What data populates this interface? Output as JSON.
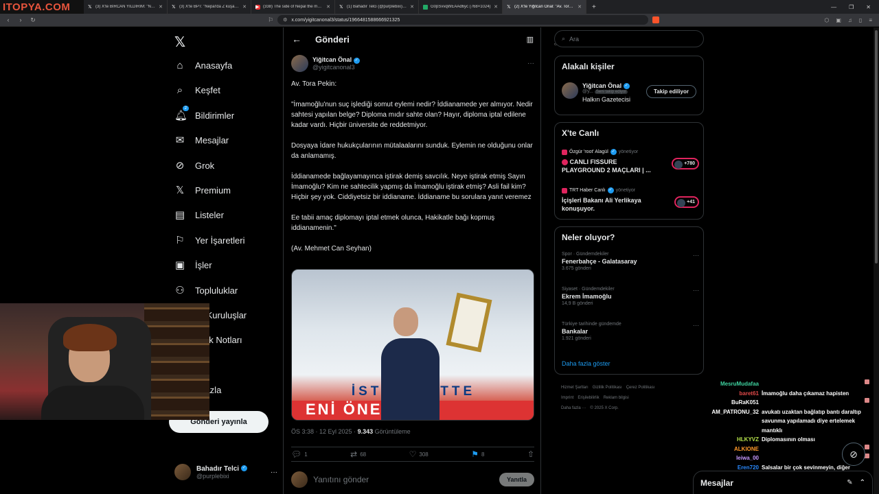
{
  "browser": {
    "watermark": "ITOPYA.COM",
    "tabs": [
      {
        "title": "(3) X'te BİRCAN YILDIRIM: \"Nepal'de",
        "fav": "𝕏",
        "kind": "x"
      },
      {
        "title": "(3) X'te BPT: \"Nepal'da Z kuşağının h",
        "fav": "𝕏",
        "kind": "x"
      },
      {
        "title": "(338) The side of Nepal the media w",
        "fav": "▶",
        "kind": "yt"
      },
      {
        "title": "(1) Bahadır Telci (@purplebixi) / X",
        "fav": "𝕏",
        "kind": "x"
      },
      {
        "title": "G0pSvvqWEAAd6yc (768×1024)",
        "fav": "",
        "kind": "img"
      },
      {
        "title": "(2) X'te Yiğitcan Önal: \"Av. Tora P",
        "fav": "𝕏",
        "kind": "x",
        "active": true
      }
    ],
    "url": "x.com/yigitcanonal3/status/1966481588666921325"
  },
  "nav": {
    "logo": "𝕏",
    "items": [
      {
        "label": "Anasayfa",
        "icon": "⌂",
        "name": "home-icon"
      },
      {
        "label": "Keşfet",
        "icon": "⌕",
        "name": "search-icon"
      },
      {
        "label": "Bildirimler",
        "icon": "🔔︎",
        "name": "bell-icon",
        "badge": "2"
      },
      {
        "label": "Mesajlar",
        "icon": "✉",
        "name": "mail-icon"
      },
      {
        "label": "Grok",
        "icon": "⊘",
        "name": "grok-icon"
      },
      {
        "label": "Premium",
        "icon": "𝕏",
        "name": "premium-icon"
      },
      {
        "label": "Listeler",
        "icon": "▤",
        "name": "list-icon"
      },
      {
        "label": "Yer İşaretleri",
        "icon": "⚐",
        "name": "bookmark-icon"
      },
      {
        "label": "İşler",
        "icon": "▣",
        "name": "briefcase-icon"
      },
      {
        "label": "Topluluklar",
        "icon": "⚇",
        "name": "communities-icon"
      },
      {
        "label": "ylı Kuruluşlar",
        "icon": "",
        "name": "verified-orgs-icon"
      },
      {
        "label": "luluk Notları",
        "icon": "",
        "name": "community-notes-icon"
      },
      {
        "label": "il",
        "icon": "",
        "name": "profile-icon"
      },
      {
        "label": "a fazla",
        "icon": "",
        "name": "more-icon"
      }
    ],
    "post_button": "Gönderi yayınla",
    "me": {
      "name": "Bahadır Telci",
      "handle": "@purplebixi"
    }
  },
  "post": {
    "header": "Gönderi",
    "author": {
      "name": "Yiğitcan Önal",
      "handle": "@yigitcanonal3"
    },
    "paragraphs": [
      "Av. Tora Pekin:",
      "\"İmamoğlu'nun suç işlediği somut eylemi nedir? İddianamede yer almıyor. Nedir sahtesi yapılan belge? Diploma mıdır sahte olan? Hayır, diploma iptal edilene kadar vardı. Hiçbir üniversite de reddetmiyor.",
      "Dosyaya İdare hukukçularının mütalaalarını sunduk. Eylemin ne olduğunu onlar da anlamamış.",
      "İddianamede bağlayamayınca iştirak demiş savcılık. Neye iştirak etmiş Sayın İmamoğlu? Kim ne sahtecilik yapmış da İmamoğlu iştirak etmiş? Asli fail kim? Hiçbir şey yok. Ciddiyetsiz bir iddianame. İddianame bu sorulara yanıt veremez",
      "Ee tabii amaç diplomayı iptal etmek olunca, Hakikatle bağı kopmuş iddianamenin.\"",
      "(Av. Mehmet Can Seyhan)"
    ],
    "image_banner": "İSTAN    METTE",
    "image_red": "ENİ ÖNE",
    "time": "ÖS 3:38 · 12 Eyl 2025 · ",
    "views": "9.343",
    "views_label": " Görüntüleme",
    "actions": {
      "replies": "1",
      "reposts": "68",
      "likes": "308",
      "bookmarks": "8"
    },
    "reply_placeholder": "Yanıtını gönder",
    "reply_button": "Yanıtla"
  },
  "sidebar": {
    "search_placeholder": "Ara",
    "related": {
      "title": "Alakalı kişiler",
      "name": "Yiğitcan Önal",
      "handle": "@y...",
      "follows_you": "Seni takip ediyor",
      "bio": "Halkın Gazetecisi",
      "follow_label": "Takip ediliyor"
    },
    "live": {
      "title": "X'te Canlı",
      "items": [
        {
          "host": "Özgür 'root' Alagül",
          "role": "yönetiyor",
          "title": "CANLI FISSURE PLAYGROUND 2 MAÇLARI | ...",
          "count": "+780"
        },
        {
          "host": "TRT Haber Canlı",
          "role": "yönetiyor",
          "title": "İçişleri Bakanı Ali Yerlikaya konuşuyor.",
          "count": "+41"
        }
      ]
    },
    "trends": {
      "title": "Neler oluyor?",
      "items": [
        {
          "category": "Spor · Gündemdekiler",
          "topic": "Fenerbahçe - Galatasaray",
          "count": "3.675 gönderi"
        },
        {
          "category": "Siyaset · Gündemdekiler",
          "topic": "Ekrem İmamoğlu",
          "count": "14,9 B gönderi"
        },
        {
          "category": "Türkiye tarihinde gündemde",
          "topic": "Bankalar",
          "count": "1.921 gönderi"
        }
      ],
      "show_more": "Daha fazla göster"
    },
    "footer": [
      "Hizmet Şartları",
      "Gizlilik Politikası",
      "Çerez Politikası",
      "Imprint",
      "Erişilebilirlik",
      "Reklam bilgisi",
      "Daha fazla ···",
      "© 2025 X Corp."
    ]
  },
  "chat": [
    {
      "user": "MesruMudafaa",
      "color": "#3fd3a0",
      "msg": "",
      "emote": true
    },
    {
      "user": "baret61",
      "color": "#e24a4a",
      "msg": "İmamoğlu daha çıkamaz hapisten"
    },
    {
      "user": "BuRaK051",
      "color": "#ffffff",
      "msg": "",
      "emote": true
    },
    {
      "user": "AM_PATRONU_32",
      "color": "#ffffff",
      "msg": "avukatı uzaktan bağlatıp bantı daraltıp savunma yapılamadı diye ertelemek mantıklı"
    },
    {
      "user": "HLKYVZ",
      "color": "#b4e04a",
      "msg": "Diplomasının olması"
    },
    {
      "user": "ALKIONE",
      "color": "#ff9a2a",
      "msg": "",
      "emote": true
    },
    {
      "user": "leiwa_00",
      "color": "#c89aff",
      "msg": "",
      "emote": true
    },
    {
      "user": "Eren720",
      "color": "#2a8aff",
      "msg": "Salsalar bir çok sevinmeyin, diğer belediyede olduğu gibi bir daha alırlar."
    }
  ],
  "messages_bar": "Mesajlar"
}
